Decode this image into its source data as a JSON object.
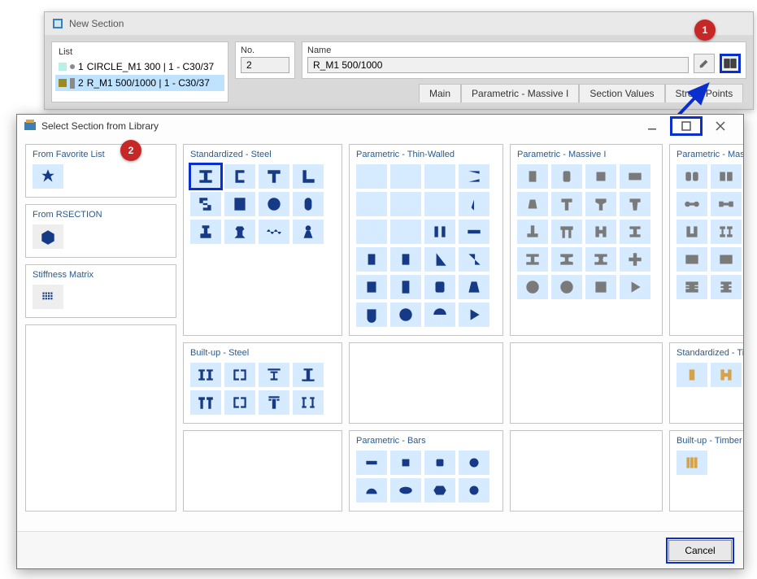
{
  "back_window": {
    "title": "New Section",
    "list": {
      "header": "List",
      "rows": [
        {
          "idx": "1",
          "name": "CIRCLE_M1 300 | 1 - C30/37",
          "selected": false
        },
        {
          "idx": "2",
          "name": "R_M1 500/1000 | 1 - C30/37",
          "selected": true
        }
      ]
    },
    "no": {
      "label": "No.",
      "value": "2"
    },
    "name": {
      "label": "Name",
      "value": "R_M1 500/1000"
    },
    "tabs": [
      "Main",
      "Parametric - Massive I",
      "Section Values",
      "Stress Points"
    ]
  },
  "callouts": {
    "one": "1",
    "two": "2"
  },
  "front_window": {
    "title": "Select Section from Library",
    "groups": {
      "std_steel": {
        "title": "Standardized - Steel"
      },
      "thin": {
        "title": "Parametric - Thin-Walled"
      },
      "massive1": {
        "title": "Parametric - Massive I"
      },
      "massive2": {
        "title": "Parametric - Massive II"
      },
      "fav": {
        "title": "From Favorite List"
      },
      "rsection": {
        "title": "From RSECTION"
      },
      "stiff": {
        "title": "Stiffness Matrix"
      },
      "built_steel": {
        "title": "Built-up - Steel"
      },
      "bars": {
        "title": "Parametric - Bars"
      },
      "std_timber": {
        "title": "Standardized - Timber"
      },
      "built_timber": {
        "title": "Built-up - Timber"
      }
    },
    "cancel": "Cancel"
  }
}
